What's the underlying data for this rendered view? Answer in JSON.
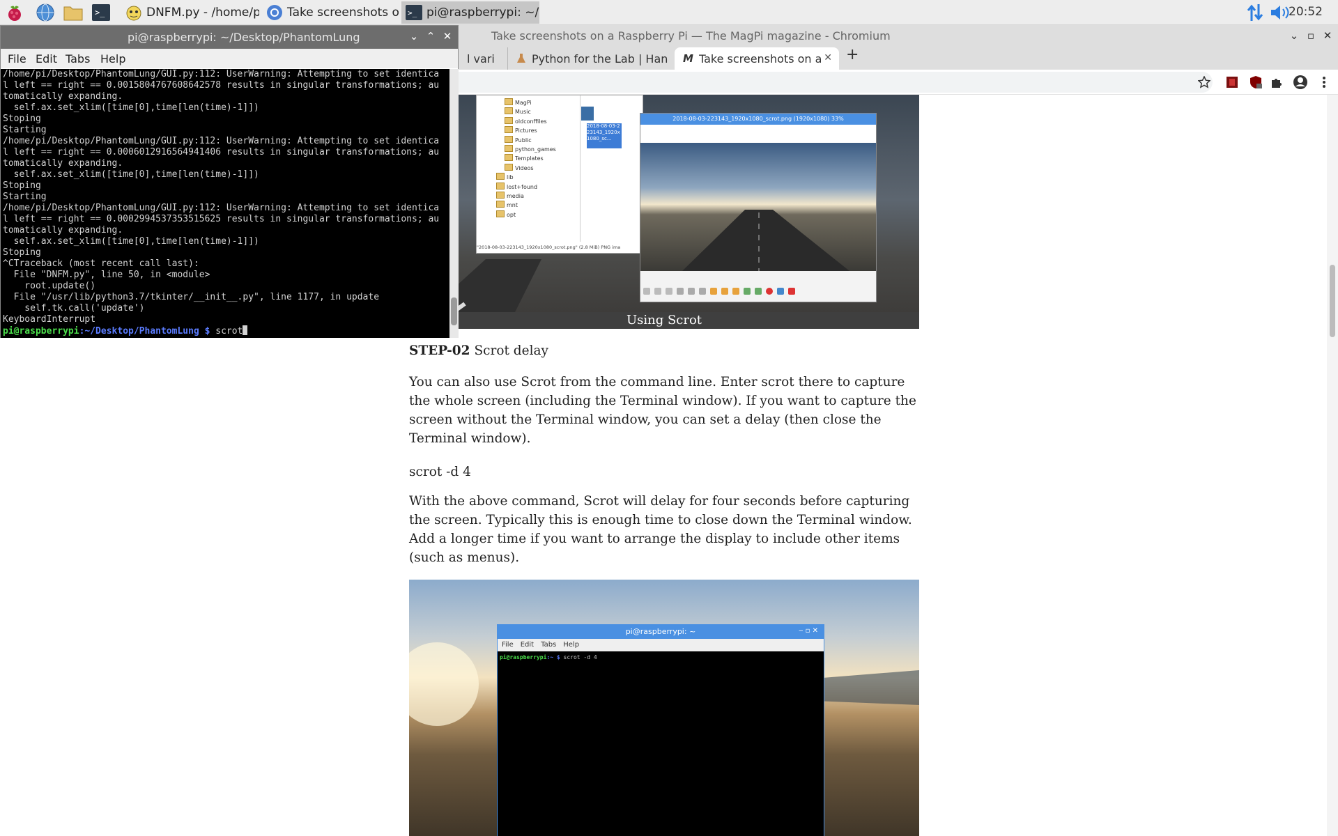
{
  "taskbar": {
    "tasks": [
      {
        "label": "DNFM.py - /home/pi/..."
      },
      {
        "label": "Take screenshots on ..."
      },
      {
        "label": "pi@raspberrypi: ~/De..."
      }
    ],
    "clock": "20:52"
  },
  "browser": {
    "title": "Take screenshots on a Raspberry Pi — The MagPi magazine - Chromium",
    "tabs": [
      {
        "label": "l vari"
      },
      {
        "label": "Python for the Lab | Han"
      },
      {
        "label": "Take screenshots on a R"
      }
    ],
    "window_buttons": {
      "minimize": "⌄",
      "maximize": "▫",
      "close": "✕"
    }
  },
  "article": {
    "figure1": {
      "caption": "Using Scrot",
      "file_manager_items": [
        "MagPi",
        "Music",
        "oldconffiles",
        "Pictures",
        "Public",
        "python_games",
        "Templates",
        "Videos",
        "lib",
        "lost+found",
        "media",
        "mnt",
        "opt"
      ],
      "file_icon_label": "2018-08-03-223143_1920x1080_sc...",
      "status_text": "\"2018-08-03-223143_1920x1080_scrot.png\" (2.8 MiB) PNG ima",
      "viewer_title": "2018-08-03-223143_1920x1080_scrot.png (1920x1080) 33%"
    },
    "step_heading_bold": "STEP-02",
    "step_heading_text": " Scrot delay",
    "para1": "You can also use Scrot from the command line. Enter scrot there to capture the whole screen (including the Terminal window). If you want to capture the screen without the Terminal window, you can set a delay (then close the Terminal window).",
    "code_line": "scrot -d 4",
    "para2": "With the above command, Scrot will delay for four seconds before capturing the screen. Typically this is enough time to close down the Terminal window. Add a longer time if you want to arrange the display to include other items (such as menus).",
    "figure2": {
      "terminal_title": "pi@raspberrypi: ~",
      "menu": [
        "File",
        "Edit",
        "Tabs",
        "Help"
      ],
      "prompt_user": "pi@raspberrypi",
      "prompt_path": ":~ $",
      "command": " scrot -d 4"
    }
  },
  "terminal": {
    "title": "pi@raspberrypi: ~/Desktop/PhantomLung",
    "menu": [
      "File",
      "Edit",
      "Tabs",
      "Help"
    ],
    "output": "/home/pi/Desktop/PhantomLung/GUI.py:112: UserWarning: Attempting to set identica\nl left == right == 0.0015804767608642578 results in singular transformations; au\ntomatically expanding.\n  self.ax.set_xlim([time[0],time[len(time)-1]])\nStoping\nStarting\n/home/pi/Desktop/PhantomLung/GUI.py:112: UserWarning: Attempting to set identica\nl left == right == 0.0006012916564941406 results in singular transformations; au\ntomatically expanding.\n  self.ax.set_xlim([time[0],time[len(time)-1]])\nStoping\nStarting\n/home/pi/Desktop/PhantomLung/GUI.py:112: UserWarning: Attempting to set identica\nl left == right == 0.0002994537353515625 results in singular transformations; au\ntomatically expanding.\n  self.ax.set_xlim([time[0],time[len(time)-1]])\nStoping\n^CTraceback (most recent call last):\n  File \"DNFM.py\", line 50, in <module>\n    root.update()\n  File \"/usr/lib/python3.7/tkinter/__init__.py\", line 1177, in update\n    self.tk.call('update')\nKeyboardInterrupt",
    "prompt_user": "pi@raspberrypi",
    "prompt_path": ":~/Desktop/PhantomLung $",
    "command": " scrot"
  }
}
